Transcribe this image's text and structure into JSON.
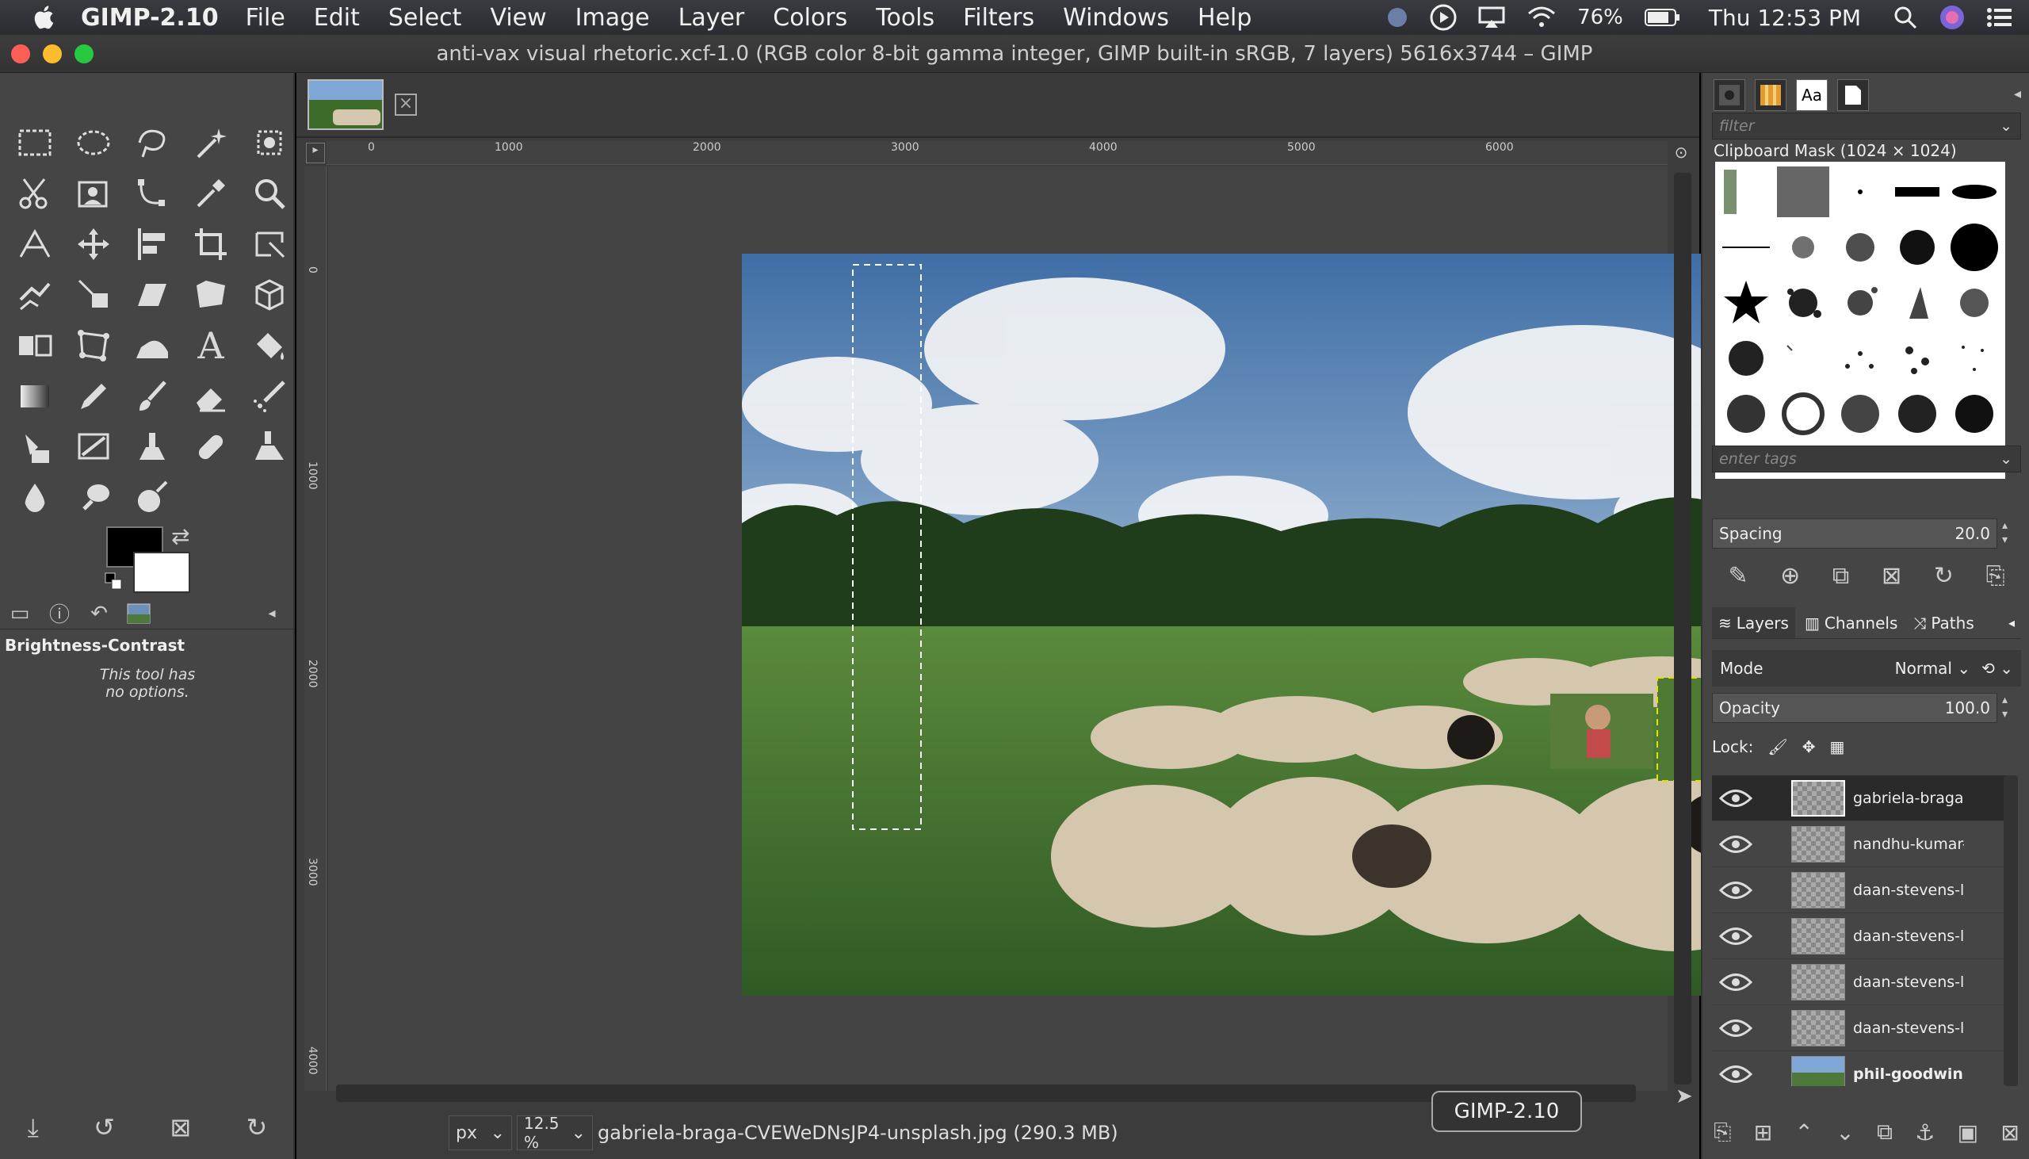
{
  "menubar": {
    "app_name": "GIMP-2.10",
    "items": [
      "File",
      "Edit",
      "Select",
      "View",
      "Image",
      "Layer",
      "Colors",
      "Tools",
      "Filters",
      "Windows",
      "Help"
    ],
    "battery": "76%",
    "clock": "Thu 12:53 PM"
  },
  "window": {
    "title": "anti-vax visual rhetoric.xcf-1.0 (RGB color 8-bit gamma integer, GIMP built-in sRGB, 7 layers) 5616x3744 – GIMP"
  },
  "toolbox": {
    "options_title": "Brightness-Contrast",
    "options_text_1": "This tool has",
    "options_text_2": "no options."
  },
  "ruler": {
    "h_labels": [
      "0",
      "1000",
      "2000",
      "3000",
      "4000",
      "5000",
      "6000"
    ],
    "v_labels": [
      "0",
      "1000",
      "2000",
      "3000",
      "4000"
    ]
  },
  "statusbar": {
    "unit": "px",
    "zoom": "12.5 %",
    "file_info": "gabriela-braga-CVEWeDNsJP4-unsplash.jpg (290.3 MB)"
  },
  "tooltip": "GIMP-2.10",
  "dock": {
    "tab_font": "Aa",
    "filter_placeholder": "filter",
    "brush_title": "Clipboard Mask (1024 × 1024)",
    "tags_placeholder": "enter tags",
    "spacing_label": "Spacing",
    "spacing_value": "20.0",
    "tabs": [
      "Layers",
      "Channels",
      "Paths"
    ],
    "mode_label": "Mode",
    "mode_value": "Normal",
    "opacity_label": "Opacity",
    "opacity_value": "100.0",
    "lock_label": "Lock:",
    "layers": [
      {
        "name": "gabriela-braga-",
        "selected": true
      },
      {
        "name": "nandhu-kumar-",
        "selected": false
      },
      {
        "name": "daan-stevens-l",
        "selected": false
      },
      {
        "name": "daan-stevens-l",
        "selected": false
      },
      {
        "name": "daan-stevens-l",
        "selected": false
      },
      {
        "name": "daan-stevens-l",
        "selected": false
      },
      {
        "name": "phil-goodwin-",
        "selected": false
      }
    ]
  }
}
